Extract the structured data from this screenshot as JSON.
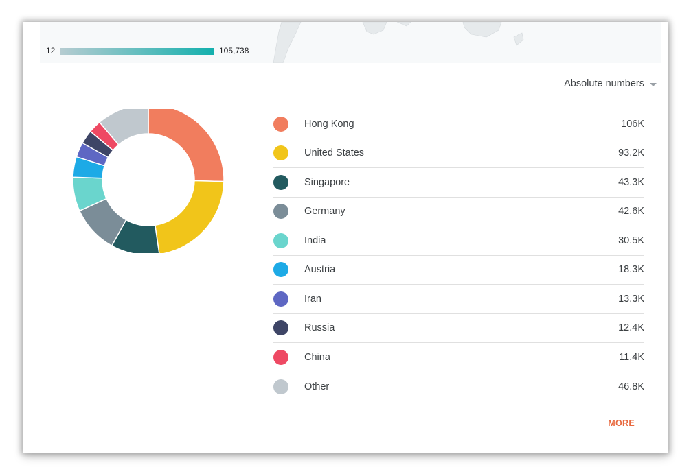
{
  "legend": {
    "min_label": "12",
    "max_label": "105,738"
  },
  "metric_selector": {
    "label": "Absolute numbers"
  },
  "countries": [
    {
      "name": "Hong Kong",
      "value_label": "106K",
      "value": 106,
      "color": "#f17d5e"
    },
    {
      "name": "United States",
      "value_label": "93.2K",
      "value": 93.2,
      "color": "#f1c51a"
    },
    {
      "name": "Singapore",
      "value_label": "43.3K",
      "value": 43.3,
      "color": "#225a5f"
    },
    {
      "name": "Germany",
      "value_label": "42.6K",
      "value": 42.6,
      "color": "#7b8d98"
    },
    {
      "name": "India",
      "value_label": "30.5K",
      "value": 30.5,
      "color": "#6ad5cd"
    },
    {
      "name": "Austria",
      "value_label": "18.3K",
      "value": 18.3,
      "color": "#1daae6"
    },
    {
      "name": "Iran",
      "value_label": "13.3K",
      "value": 13.3,
      "color": "#5e67c3"
    },
    {
      "name": "Russia",
      "value_label": "12.4K",
      "value": 12.4,
      "color": "#3e4566"
    },
    {
      "name": "China",
      "value_label": "11.4K",
      "value": 11.4,
      "color": "#ee4963"
    },
    {
      "name": "Other",
      "value_label": "46.8K",
      "value": 46.8,
      "color": "#c0c8ce"
    }
  ],
  "more_label": "MORE"
}
